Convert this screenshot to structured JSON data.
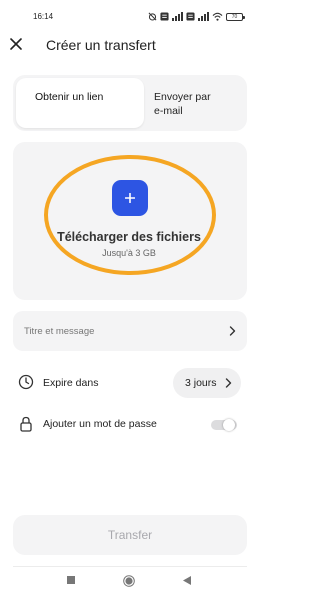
{
  "status_bar": {
    "time": "16:14",
    "battery": "70"
  },
  "header": {
    "title": "Créer un transfert"
  },
  "tabs": {
    "active_label": "Obtenir un lien",
    "inactive_label": "Envoyer par\ne-mail"
  },
  "upload": {
    "title": "Télécharger des fichiers",
    "subtitle": "Jusqu'à 3 GB"
  },
  "message_row": {
    "placeholder": "Titre et message"
  },
  "expiry": {
    "label": "Expire dans",
    "value": "3 jours"
  },
  "password": {
    "label": "Ajouter un mot de passe",
    "enabled": false
  },
  "actions": {
    "transfer_label": "Transfer"
  },
  "colors": {
    "accent": "#2d55e3",
    "highlight": "#f5a623",
    "card_background": "#f4f4f5"
  },
  "icons": {
    "close": "close-icon",
    "add": "plus-icon",
    "clock": "clock-icon",
    "lock": "lock-icon",
    "chevron": "chevron-right-icon"
  }
}
